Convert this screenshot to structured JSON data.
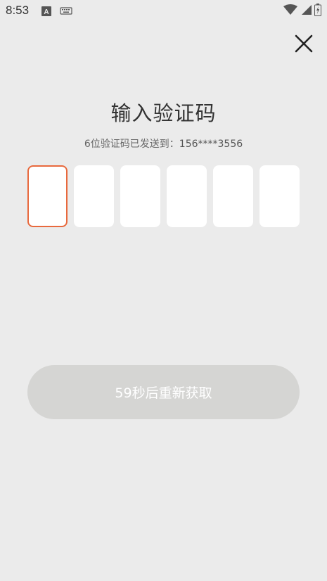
{
  "status_bar": {
    "time": "8:53",
    "icons": [
      "a-notification-icon",
      "keyboard-icon",
      "wifi-icon",
      "signal-icon",
      "battery-icon"
    ]
  },
  "dialog": {
    "close_icon": "close-icon",
    "title": "输入验证码",
    "subtitle_prefix": "6位验证码已发送到：",
    "phone_masked": "156****3556",
    "code_length": 6,
    "code_values": [
      "",
      "",
      "",
      "",
      "",
      ""
    ],
    "active_index": 0,
    "resend_label": "59秒后重新获取"
  },
  "colors": {
    "background": "#ebebeb",
    "active_border": "#e8693d",
    "button_disabled": "#d5d5d3",
    "text_primary": "#333333",
    "text_secondary": "#666666"
  }
}
